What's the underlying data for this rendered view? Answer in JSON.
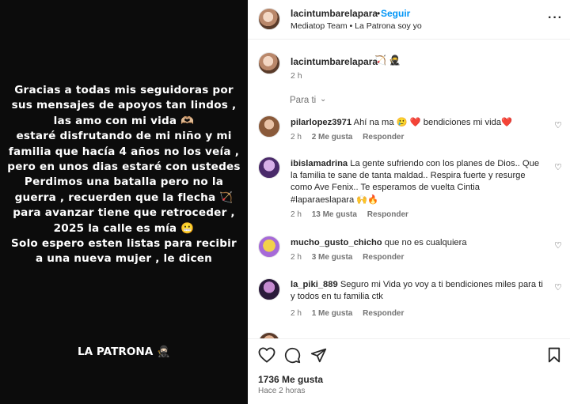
{
  "story": {
    "text": "Gracias a todas mis seguidoras por sus mensajes de apoyos tan lindos , las amo con mi vida 🫶🏼\nestaré disfrutando de mi niño y mi familia que hacía 4 años no los veía , pero en unos dias estaré con ustedes\nPerdimos una batalla pero no la guerra , recuerden que la flecha 🏹 para avanzar tiene que retroceder ,\n2025 la calle es mía 😬\nSolo espero esten listas para recibir a una nueva mujer , le dicen",
    "signature": "LA PATRONA 🥷🏻"
  },
  "header": {
    "username": "lacintumbarelapara",
    "dot": "•",
    "follow_label": "Seguir",
    "subtitle": "Mediatop Team • La Patrona soy yo",
    "more_icon": "more-horizontal-icon"
  },
  "caption": {
    "username": "lacintumbarelapara",
    "icons": "🏹 🥷",
    "time": "2 h"
  },
  "filter": {
    "label": "Para ti",
    "chevron": "⌄"
  },
  "comments": [
    {
      "user": "pilarlopez3971",
      "text": "Ahí na ma 🥲 ❤️ bendiciones mi vida❤️",
      "time": "2 h",
      "likes": "2 Me gusta",
      "reply": "Responder"
    },
    {
      "user": "ibislamadrina",
      "text": "La gente sufriendo con los planes de Dios.. Que la familia te sane de tanta maldad.. Respira fuerte y resurge como Ave Fenix.. Te esperamos de vuelta Cintia #laparaeslapara 🙌🔥",
      "time": "2 h",
      "likes": "13 Me gusta",
      "reply": "Responder"
    },
    {
      "user": "mucho_gusto_chicho",
      "text": "que no es cualquiera",
      "time": "2 h",
      "likes": "3 Me gusta",
      "reply": "Responder"
    },
    {
      "user": "la_piki_889",
      "text": "Seguro mi Vida yo voy a ti bendiciones miles para ti y todos en tu familia ctk",
      "time": "2 h",
      "likes": "1 Me gusta",
      "reply": "Responder"
    }
  ],
  "footer": {
    "likes": "1736 Me gusta",
    "ago": "Hace 2 horas"
  },
  "colors": {
    "accent": "#0095f6",
    "muted": "#737373",
    "text": "#262626",
    "story_bg": "#0c0c0c"
  }
}
